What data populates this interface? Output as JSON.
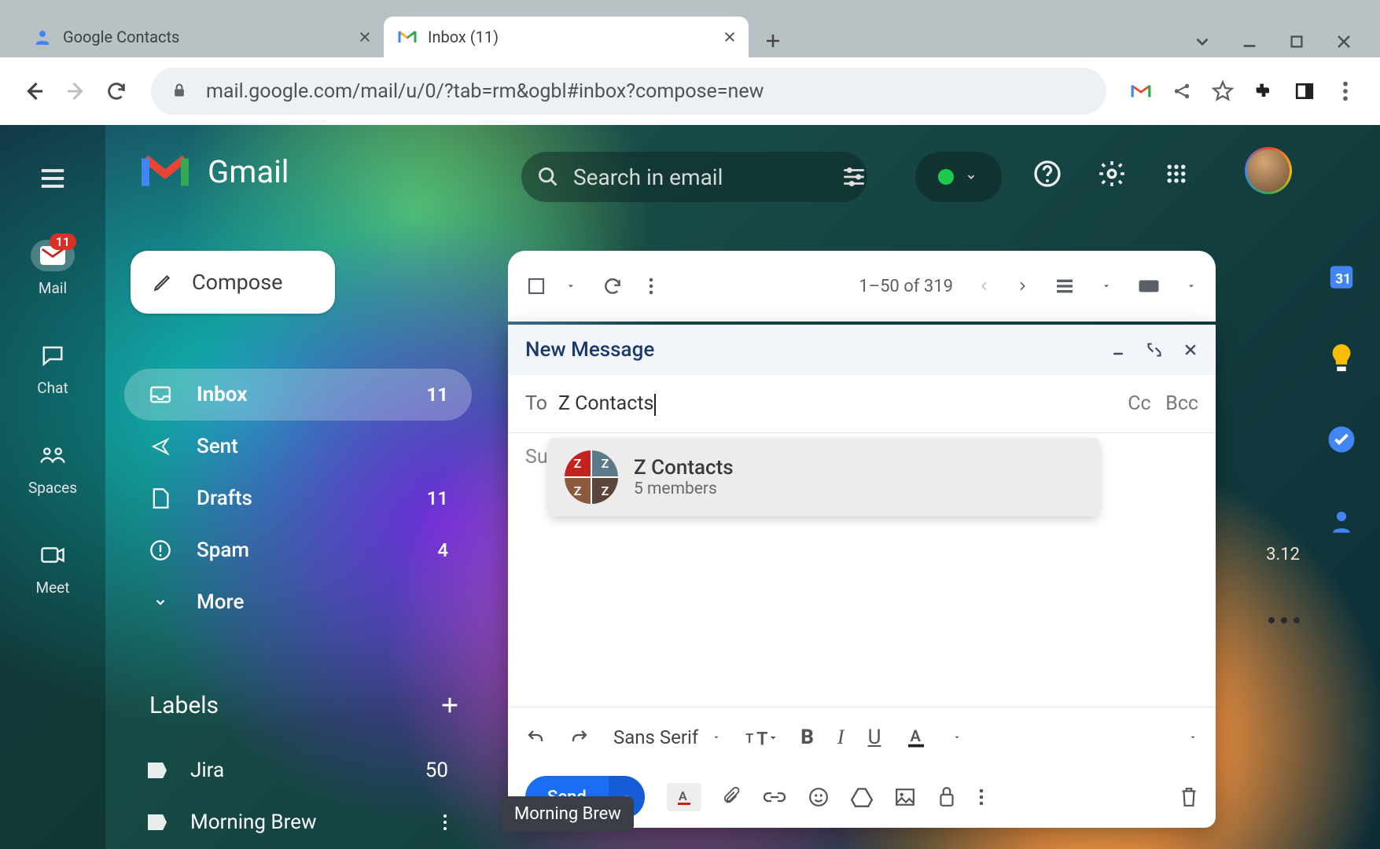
{
  "browser": {
    "tabs": [
      {
        "label": "Google Contacts"
      },
      {
        "label": "Inbox (11)"
      }
    ],
    "url": "mail.google.com/mail/u/0/?tab=rm&ogbl#inbox?compose=new"
  },
  "gmail": {
    "brand": "Gmail",
    "search_placeholder": "Search in email",
    "compose_label": "Compose",
    "mail_badge": "11",
    "rail": [
      {
        "label": "Mail"
      },
      {
        "label": "Chat"
      },
      {
        "label": "Spaces"
      },
      {
        "label": "Meet"
      }
    ],
    "folders": [
      {
        "label": "Inbox",
        "count": "11",
        "selected": true
      },
      {
        "label": "Sent",
        "count": ""
      },
      {
        "label": "Drafts",
        "count": "11"
      },
      {
        "label": "Spam",
        "count": "4"
      },
      {
        "label": "More",
        "count": ""
      }
    ],
    "labels_header": "Labels",
    "labels": [
      {
        "label": "Jira",
        "count": "50"
      },
      {
        "label": "Morning Brew",
        "count": ""
      }
    ],
    "mailtop": {
      "range": "1–50 of 319"
    },
    "compose_window": {
      "title": "New Message",
      "to_label": "To",
      "to_value": "Z Contacts",
      "cc": "Cc",
      "bcc": "Bcc",
      "subject_placeholder": "Sub",
      "font": "Sans Serif",
      "send": "Send",
      "suggestion": {
        "name": "Z Contacts",
        "members": "5 members"
      }
    },
    "tooltip": "Morning Brew",
    "side_dates": "3.12"
  }
}
